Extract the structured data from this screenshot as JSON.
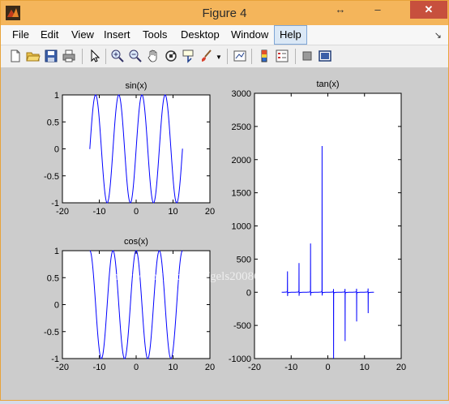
{
  "window": {
    "title": "Figure 4",
    "restore_glyph": "↔",
    "minimize_glyph": "–",
    "close_glyph": "✕"
  },
  "menu": [
    "File",
    "Edit",
    "View",
    "Insert",
    "Tools",
    "Desktop",
    "Window",
    "Help"
  ],
  "menu_active": "Help",
  "toolbar": [
    "new-figure-icon",
    "open-file-icon",
    "save-icon",
    "print-icon",
    "pointer-icon",
    "zoom-in-icon",
    "zoom-out-icon",
    "pan-icon",
    "rotate-3d-icon",
    "data-cursor-icon",
    "brush-icon",
    "link-plot-icon",
    "colorbar-icon",
    "legend-icon",
    "hide-plot-tools-icon",
    "show-plot-tools-icon"
  ],
  "watermark": "http://blog.csdn.net/gels200808",
  "colors": {
    "line": "#0000ff",
    "figure_bg": "#cccccc",
    "axes_bg": "#ffffff",
    "title_bar": "#f4b55b",
    "close_button": "#c7503d"
  },
  "chart_data": [
    {
      "type": "line",
      "title": "sin(x)",
      "xlim": [
        -20,
        20
      ],
      "ylim": [
        -1,
        1
      ],
      "xticks": [
        "-20",
        "-10",
        "0",
        "10",
        "20"
      ],
      "yticks": [
        "1",
        "0.5",
        "0",
        "-0.5",
        "-1"
      ],
      "series": [
        {
          "function": "sin",
          "x_range": [
            -12.57,
            12.57
          ],
          "color": "#0000ff"
        }
      ]
    },
    {
      "type": "line",
      "title": "cos(x)",
      "xlim": [
        -20,
        20
      ],
      "ylim": [
        -1,
        1
      ],
      "xticks": [
        "-20",
        "-10",
        "0",
        "10",
        "20"
      ],
      "yticks": [
        "1",
        "0.5",
        "0",
        "-0.5",
        "-1"
      ],
      "series": [
        {
          "function": "cos",
          "x_range": [
            -12.57,
            12.57
          ],
          "color": "#0000ff"
        }
      ]
    },
    {
      "type": "line",
      "title": "tan(x)",
      "xlim": [
        -20,
        20
      ],
      "ylim": [
        -1000,
        3000
      ],
      "xticks": [
        "-20",
        "-10",
        "0",
        "10",
        "20"
      ],
      "yticks": [
        "3000",
        "2500",
        "2000",
        "1500",
        "1000",
        "500",
        "0",
        "-500",
        "-1000"
      ],
      "series": [
        {
          "function": "tan",
          "x_range": [
            -12.57,
            12.57
          ],
          "color": "#0000ff"
        }
      ]
    }
  ]
}
